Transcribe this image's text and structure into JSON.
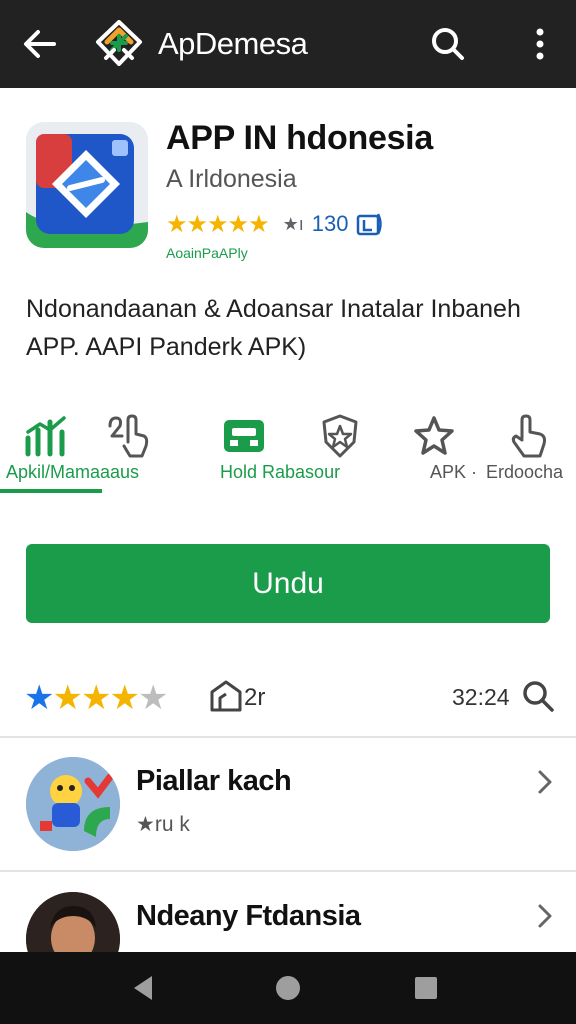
{
  "topbar": {
    "title": "ApDemesa",
    "icons": [
      "back-arrow-icon",
      "app-logo-icon",
      "search-icon",
      "more-vert-icon"
    ]
  },
  "app": {
    "name": "APP IN hdonesia",
    "developer": "A Irldonesia",
    "stars_text": "★★★★★",
    "stars_aux": "★ı",
    "rating_count": "130",
    "tag": "AoainPaAPly"
  },
  "description": "Ndonandaanan & Adoansar Inatalar Inbaneh APP. AAPI Panderk APK)",
  "features": [
    {
      "label": "Apkil/Mamaaaus",
      "icon": "chart-bars-icon",
      "color": "#1a9c4a",
      "active": true
    },
    {
      "label": "",
      "icon": "hand-pointer-icon",
      "color": "#555555",
      "active": false
    },
    {
      "label": "Hold Rabasour",
      "icon": "toolbox-icon",
      "color": "#1a9c4a",
      "active": false
    },
    {
      "label": "",
      "icon": "shield-star-icon",
      "color": "#555555",
      "active": false
    },
    {
      "label": "APK ·",
      "icon": "star-outline-icon",
      "color": "#555555",
      "active": false
    },
    {
      "label": "Erdoocha",
      "icon": "pointer-hand-icon",
      "color": "#555555",
      "active": false
    }
  ],
  "install_label": "Undu",
  "rating_bar": {
    "stars_filled": 4,
    "stars_total": 5,
    "home_count": "2r",
    "time": "32:24"
  },
  "list": [
    {
      "title": "Piallar kach",
      "subtitle": "★ru k"
    },
    {
      "title": "Ndeany Ftdansia",
      "subtitle": ""
    }
  ],
  "colors": {
    "accent": "#1a9c4a",
    "topbar": "#222222",
    "star": "#f4b400",
    "star_blue": "#1a73e8"
  }
}
